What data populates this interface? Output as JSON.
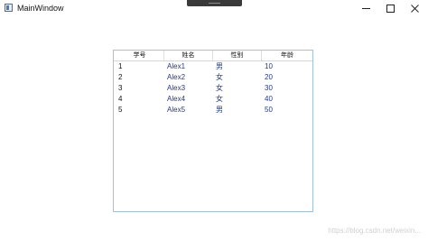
{
  "window": {
    "title": "MainWindow",
    "icon": "app-window-icon"
  },
  "controls": {
    "minimize_icon": "minimize-icon",
    "maximize_icon": "maximize-icon",
    "close_icon": "close-icon"
  },
  "grid": {
    "columns": [
      "学号",
      "姓名",
      "性别",
      "年龄"
    ],
    "rows": [
      [
        "1",
        "Alex1",
        "男",
        "10"
      ],
      [
        "2",
        "Alex2",
        "女",
        "20"
      ],
      [
        "3",
        "Alex3",
        "女",
        "30"
      ],
      [
        "4",
        "Alex4",
        "女",
        "40"
      ],
      [
        "5",
        "Alex5",
        "男",
        "50"
      ]
    ]
  },
  "watermark": "https://blog.csdn.net/weixin..."
}
